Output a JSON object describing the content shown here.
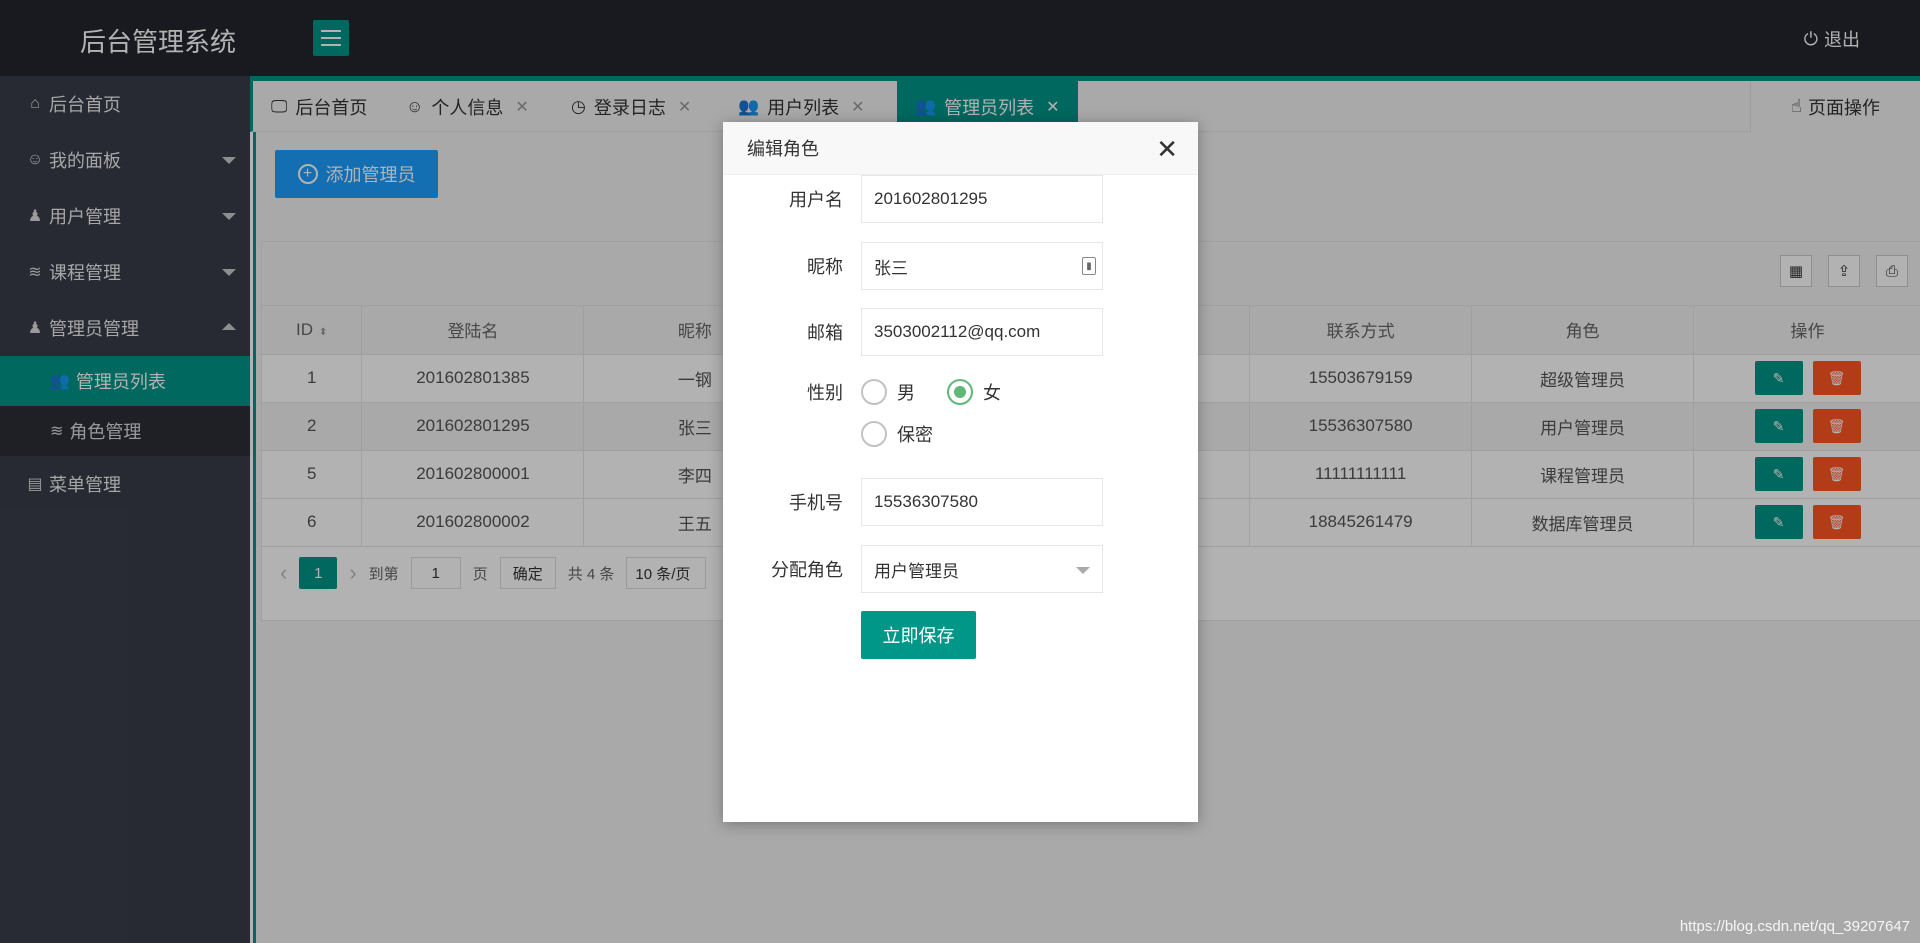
{
  "header": {
    "logo": "后台管理系统",
    "logout": "退出"
  },
  "sidebar": {
    "items": [
      {
        "label": "后台首页",
        "icon": "home-icon"
      },
      {
        "label": "我的面板",
        "icon": "user-outline-icon"
      },
      {
        "label": "用户管理",
        "icon": "user-icon"
      },
      {
        "label": "课程管理",
        "icon": "layers-icon"
      },
      {
        "label": "管理员管理",
        "icon": "user-icon"
      },
      {
        "label": "菜单管理",
        "icon": "menu-icon"
      }
    ],
    "subitems": [
      {
        "label": "管理员列表",
        "icon": "users-icon",
        "active": true
      },
      {
        "label": "角色管理",
        "icon": "layers-icon",
        "active": false
      }
    ]
  },
  "tabs": [
    {
      "label": "后台首页",
      "icon": "monitor-icon"
    },
    {
      "label": "个人信息",
      "icon": "user-outline-icon"
    },
    {
      "label": "登录日志",
      "icon": "clock-icon"
    },
    {
      "label": "用户列表",
      "icon": "users-icon"
    },
    {
      "label": "管理员列表",
      "icon": "users-icon"
    }
  ],
  "page_ops": "页面操作",
  "toolbar": {
    "add_label": "添加管理员"
  },
  "table": {
    "headers": [
      "ID",
      "登陆名",
      "昵称",
      "",
      "",
      "联系方式",
      "角色",
      "操作"
    ],
    "rows": [
      {
        "id": "1",
        "login": "201602801385",
        "nick": "一钢",
        "phone": "15503679159",
        "role": "超级管理员"
      },
      {
        "id": "2",
        "login": "201602801295",
        "nick": "张三",
        "phone": "15536307580",
        "role": "用户管理员"
      },
      {
        "id": "5",
        "login": "201602800001",
        "nick": "李四",
        "phone": "11111111111",
        "role": "课程管理员"
      },
      {
        "id": "6",
        "login": "201602800002",
        "nick": "王五",
        "phone": "18845261479",
        "role": "数据库管理员"
      }
    ]
  },
  "pager": {
    "current": "1",
    "goto_label": "到第",
    "goto_value": "1",
    "page_label": "页",
    "confirm": "确定",
    "total": "共 4 条",
    "per_page": "10 条/页"
  },
  "modal": {
    "title": "编辑角色",
    "username_label": "用户名",
    "username": "201602801295",
    "nickname_label": "昵称",
    "nickname": "张三",
    "email_label": "邮箱",
    "email": "3503002112@qq.com",
    "gender_label": "性别",
    "gender_options": [
      "男",
      "女",
      "保密"
    ],
    "gender_selected": "女",
    "phone_label": "手机号",
    "phone": "15536307580",
    "role_label": "分配角色",
    "role": "用户管理员",
    "save": "立即保存"
  },
  "watermark": "https://blog.csdn.net/qq_39207647",
  "colors": {
    "header_bg": "#23262e",
    "sidebar_bg": "#393d49",
    "accent": "#009688",
    "primary_blue": "#1e9fff",
    "danger": "#ff5722",
    "radio_green": "#5fb878"
  }
}
